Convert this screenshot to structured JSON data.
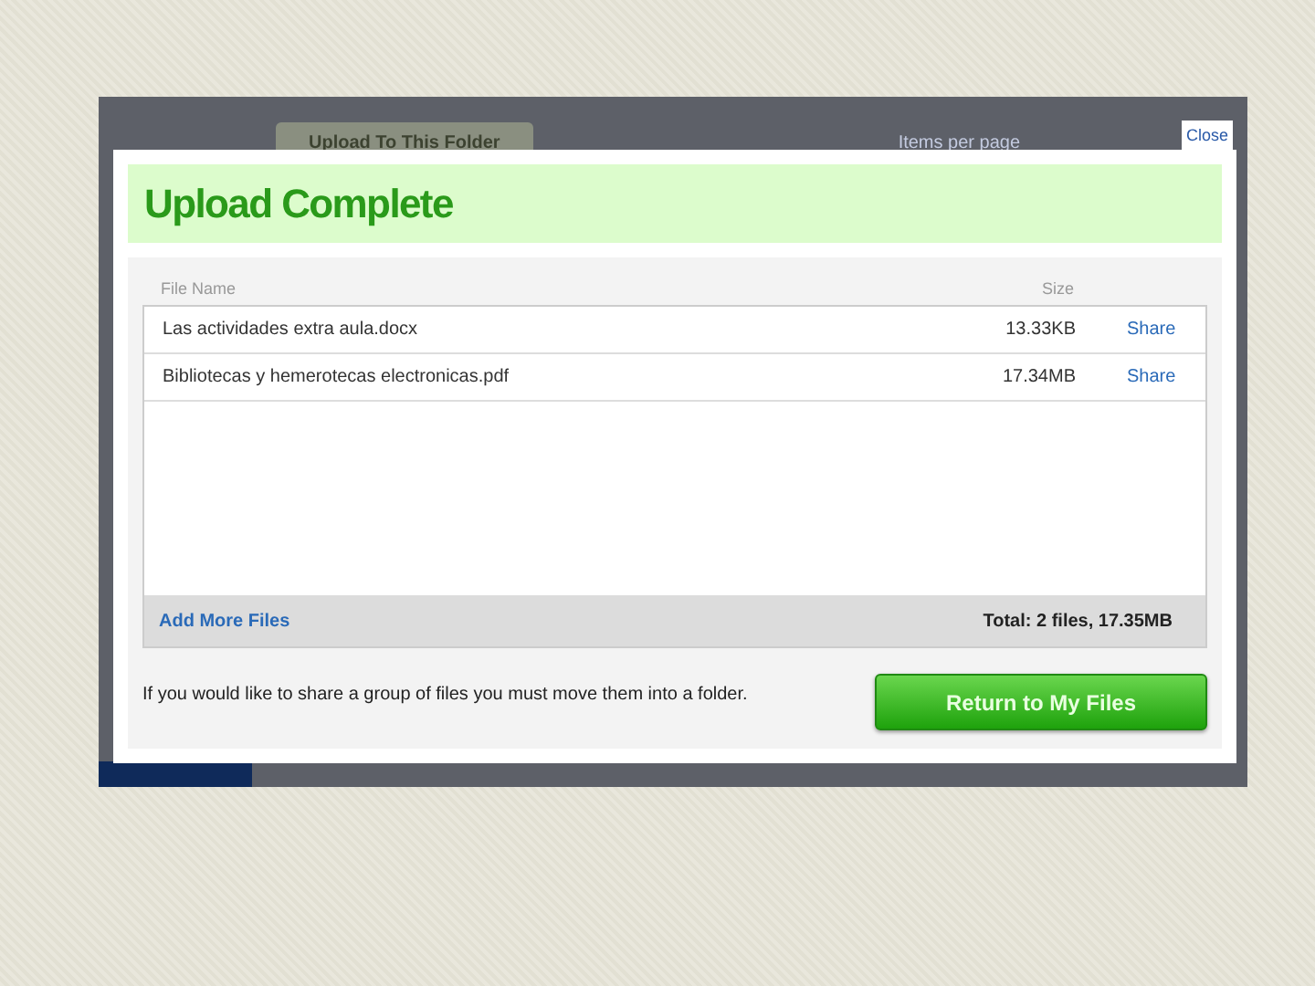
{
  "background_page": {
    "upload_button": "Upload To This Folder",
    "items_per_page": "Items per page",
    "close_tab": "Close"
  },
  "dialog": {
    "title": "Upload Complete",
    "columns": [
      "File Name",
      "Size"
    ],
    "files": [
      {
        "name": "Las actividades extra aula.docx",
        "size": "13.33KB",
        "action": "Share"
      },
      {
        "name": "Bibliotecas y hemerotecas electronicas.pdf",
        "size": "17.34MB",
        "action": "Share"
      }
    ],
    "add_more": "Add More Files",
    "total": "Total: 2 files, 17.35MB",
    "note": "If you would like to share a group of files you must move them into a folder.",
    "return_button": "Return to My Files"
  }
}
